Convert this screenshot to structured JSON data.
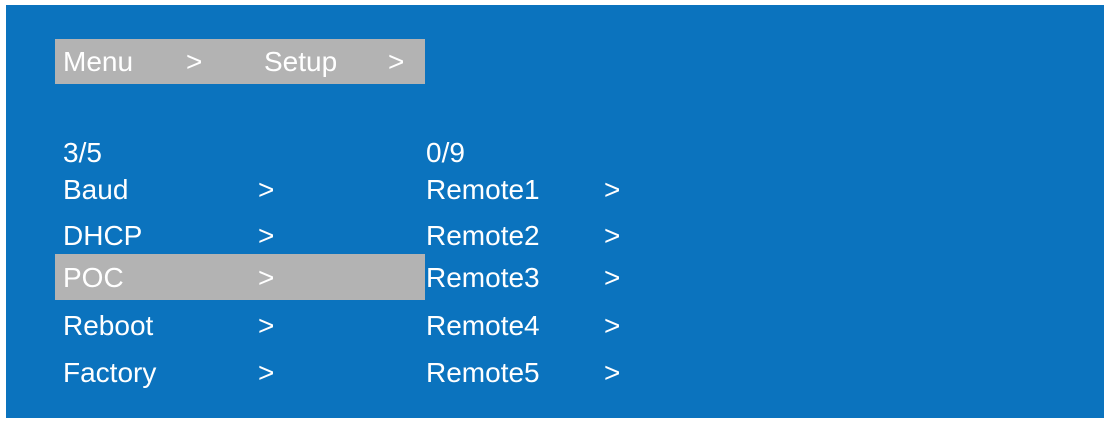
{
  "breadcrumb": {
    "item1": "Menu",
    "sep1": ">",
    "item2": "Setup",
    "sep2": ">"
  },
  "left_menu": {
    "position": "3/5",
    "items": [
      {
        "label": "Baud",
        "arrow": ">"
      },
      {
        "label": "DHCP",
        "arrow": ">"
      },
      {
        "label": "POC",
        "arrow": ">"
      },
      {
        "label": "Reboot",
        "arrow": ">"
      },
      {
        "label": "Factory",
        "arrow": ">"
      }
    ],
    "selected_index": 2
  },
  "right_menu": {
    "position": "0/9",
    "items": [
      {
        "label": "Remote1",
        "arrow": ">"
      },
      {
        "label": "Remote2",
        "arrow": ">"
      },
      {
        "label": "Remote3",
        "arrow": ">"
      },
      {
        "label": "Remote4",
        "arrow": ">"
      },
      {
        "label": "Remote5",
        "arrow": ">"
      }
    ]
  },
  "colors": {
    "screen_background": "#0b73be",
    "highlight": "#b3b3b3",
    "text": "#ffffff"
  }
}
